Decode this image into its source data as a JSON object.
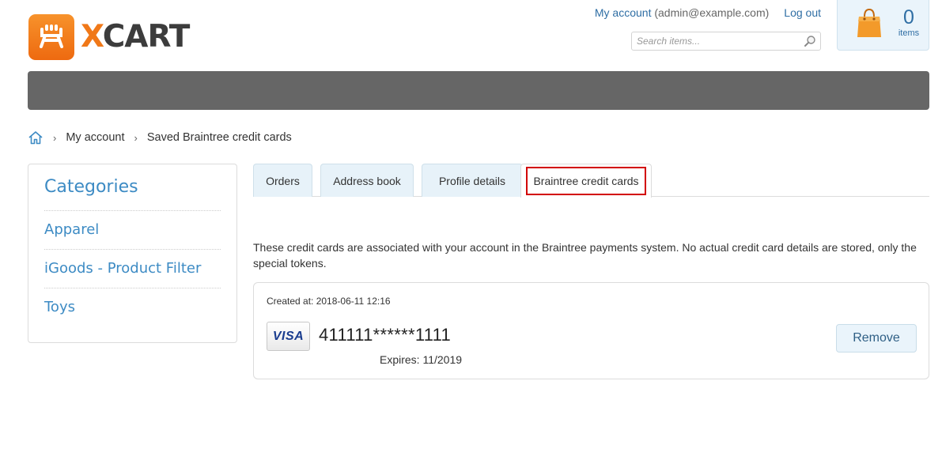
{
  "logo": {
    "text_x": "X",
    "text_rest": "CART"
  },
  "header": {
    "my_account_label": "My account",
    "account_email": "(admin@example.com)",
    "logout_label": "Log out",
    "search_placeholder": "Search items..."
  },
  "cart": {
    "count": "0",
    "label": "items"
  },
  "breadcrumb": {
    "items": [
      "My account",
      "Saved Braintree credit cards"
    ],
    "separator": "›"
  },
  "sidebar": {
    "title": "Categories",
    "items": [
      "Apparel",
      "iGoods - Product Filter",
      "Toys"
    ]
  },
  "tabs": [
    {
      "label": "Orders"
    },
    {
      "label": "Address book"
    },
    {
      "label": "Profile details"
    },
    {
      "label": "Braintree credit cards",
      "active": true
    }
  ],
  "main": {
    "intro": "These credit cards are associated with your account in the Braintree payments system. No actual credit card details are stored, only the special tokens.",
    "card": {
      "created": "Created at: 2018-06-11 12:16",
      "brand": "VISA",
      "number": "411111******1111",
      "expires": "Expires: 11/2019",
      "remove_label": "Remove"
    }
  },
  "colors": {
    "accent_orange": "#f07818",
    "link_blue": "#2f6ea4",
    "category_blue": "#3d8bc4",
    "navbar_gray": "#666666",
    "active_tab_outline": "#d20000"
  },
  "icons": {
    "search": "magnifier-icon",
    "cart": "shopping-bag-icon",
    "home": "home-icon"
  }
}
